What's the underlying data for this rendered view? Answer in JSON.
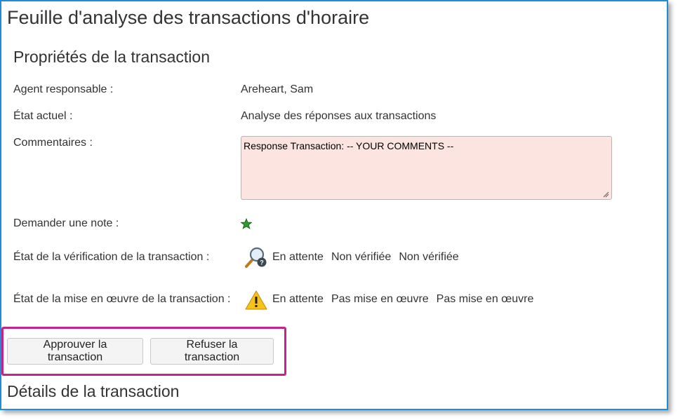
{
  "page_title": "Feuille d'analyse des transactions d'horaire",
  "properties": {
    "heading": "Propriétés de la transaction",
    "agent_label": "Agent responsable :",
    "agent_value": "Areheart, Sam",
    "state_label": "État actuel :",
    "state_value": "Analyse des réponses aux transactions",
    "comments_label": "Commentaires :",
    "comments_value": "Response Transaction: -- YOUR COMMENTS --",
    "rating_label": "Demander une note :",
    "rating_icon": "star-icon",
    "rating_color": "#2e9b2e",
    "verification_label": "État de la vérification de la transaction :",
    "verification_icon": "magnifier-question-icon",
    "verification_values": [
      "En attente",
      "Non vérifiée",
      "Non vérifiée"
    ],
    "implementation_label": "État de la mise en œuvre de la transaction :",
    "implementation_icon": "warning-icon",
    "implementation_values": [
      "En attente",
      "Pas mise en œuvre",
      "Pas mise en œuvre"
    ]
  },
  "actions": {
    "approve_label": "Approuver la transaction",
    "refuse_label": "Refuser la transaction",
    "highlight_color": "#c4248a"
  },
  "details_heading": "Détails de la transaction",
  "colors": {
    "frame_border": "#1e8fd6",
    "comment_bg": "#fce5e1"
  }
}
